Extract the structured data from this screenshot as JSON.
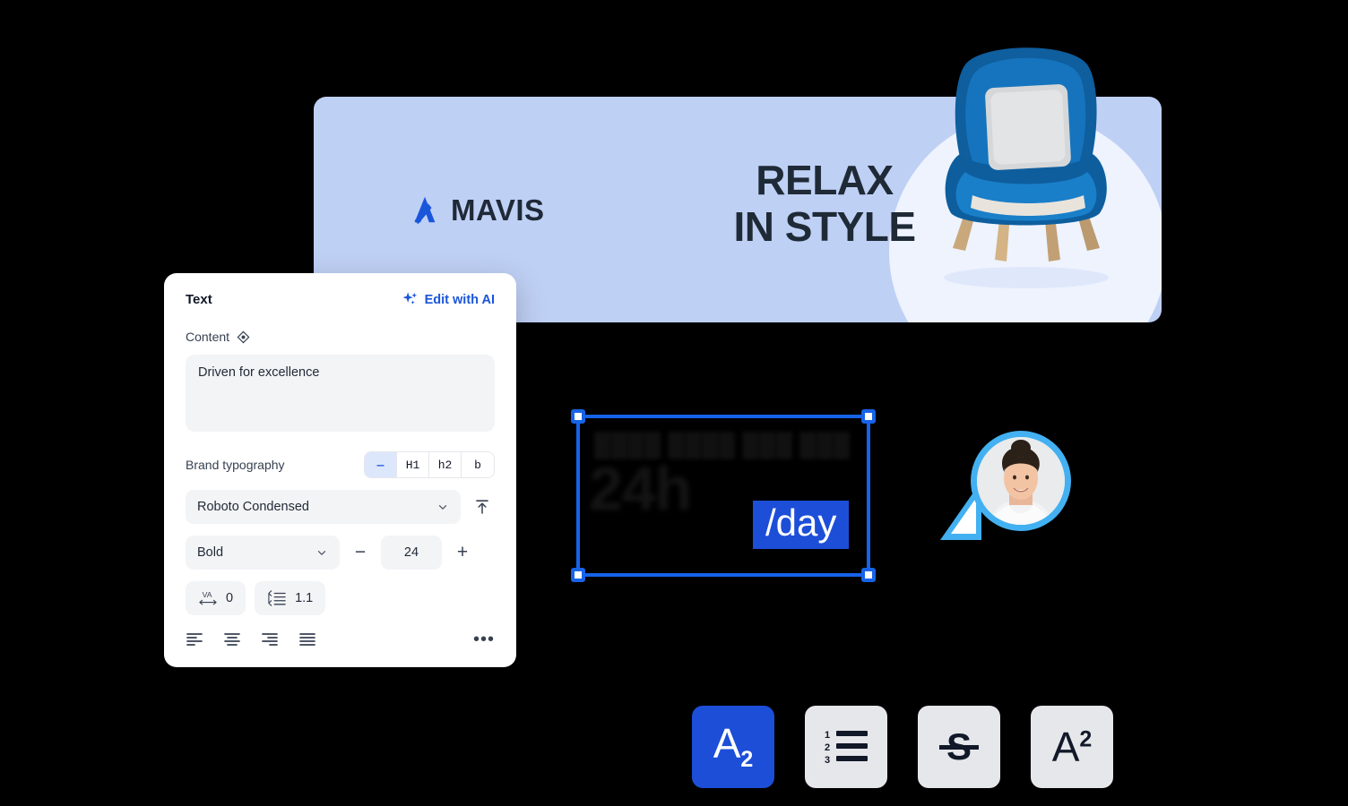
{
  "banner": {
    "logo_text": "MAVIS",
    "logo_icon": "mavis-a-mark-icon",
    "headline_line1": "RELAX",
    "headline_line2": "IN STYLE",
    "background_color": "#bfd0f5",
    "circle_color": "#eef3fe",
    "chair_color": "#1262a8",
    "pillow_color": "#d5d7d9",
    "leg_color": "#c9a87c"
  },
  "panel": {
    "title": "Text",
    "edit_ai_label": "Edit with AI",
    "edit_ai_icon": "sparkles-icon",
    "edit_ai_color": "#1a56db",
    "content_label": "Content",
    "content_icon": "dynamic-field-diamond-icon",
    "content_value": "Driven for excellence",
    "brand_typography_label": "Brand typography",
    "presets": [
      {
        "label": "—",
        "name": "preset-body",
        "active": true
      },
      {
        "label": "H1",
        "name": "preset-h1",
        "active": false
      },
      {
        "label": "h2",
        "name": "preset-h2",
        "active": false
      },
      {
        "label": "b",
        "name": "preset-bold",
        "active": false
      }
    ],
    "font_family": "Roboto Condensed",
    "font_family_caret": "chevron-down-icon",
    "upload_icon": "upload-font-icon",
    "font_style": "Bold",
    "font_style_caret": "chevron-down-icon",
    "size_decrease": "−",
    "font_size": "24",
    "size_increase": "+",
    "letter_spacing_icon": "letter-spacing-icon",
    "letter_spacing_value": "0",
    "line_height_icon": "line-height-icon",
    "line_height_value": "1.1",
    "align_options": [
      {
        "name": "align-left-icon"
      },
      {
        "name": "align-center-icon"
      },
      {
        "name": "align-right-icon"
      },
      {
        "name": "align-justify-icon"
      }
    ],
    "more_label": "•••"
  },
  "canvas": {
    "selection": {
      "blurred_line_small": "████ ████ ███ ███",
      "blurred_line_big": "24h",
      "highlighted_text": "/day",
      "highlight_color": "#1d4ed8",
      "selection_color": "#1763e8"
    },
    "avatar": {
      "ring_color": "#43b0f1",
      "cursor_icon": "collaborator-cursor-icon"
    }
  },
  "format_toolbar": {
    "buttons": [
      {
        "name": "subscript-button",
        "glyph": "A",
        "mod": "2",
        "mod_type": "sub",
        "active": true
      },
      {
        "name": "numbered-list-button",
        "glyph": "",
        "mod": "",
        "mod_type": "icon",
        "active": false
      },
      {
        "name": "strikethrough-button",
        "glyph": "",
        "mod": "",
        "mod_type": "icon",
        "active": false
      },
      {
        "name": "superscript-button",
        "glyph": "A",
        "mod": "2",
        "mod_type": "sup",
        "active": false
      }
    ],
    "active_color": "#1d4ed8",
    "inactive_color": "#e5e7eb"
  }
}
